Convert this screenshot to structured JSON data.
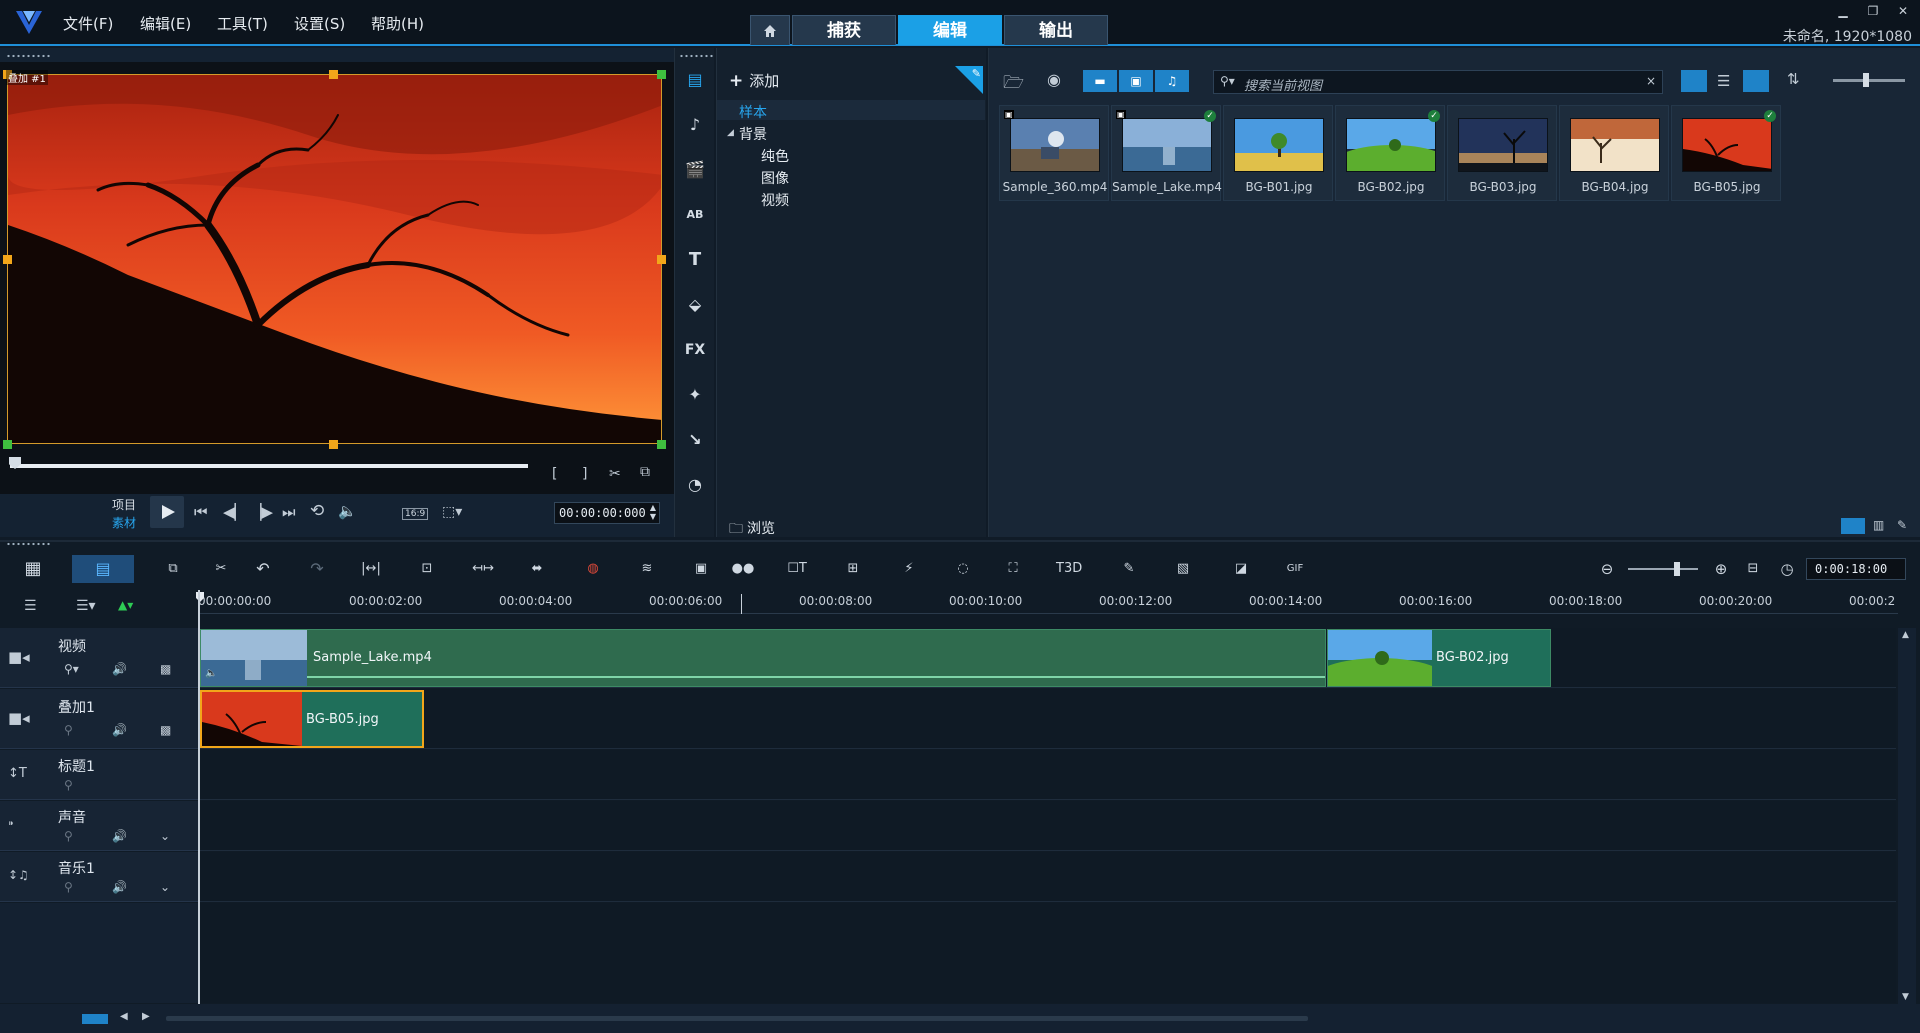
{
  "menubar": {
    "items": [
      "文件(F)",
      "编辑(E)",
      "工具(T)",
      "设置(S)",
      "帮助(H)"
    ],
    "tabs": [
      "捕获",
      "编辑",
      "输出"
    ],
    "active_tab": "编辑",
    "project_info": "未命名, 1920*1080"
  },
  "preview": {
    "overlay_label": "叠加 #1",
    "mode_project": "项目",
    "mode_clip": "素材",
    "aspect": "16:9",
    "timecode": "00:00:00:000"
  },
  "library": {
    "add_label": "添加",
    "tree": {
      "sample": "样本",
      "background": "背景",
      "children": [
        "纯色",
        "图像",
        "视频"
      ]
    },
    "browse_label": "浏览",
    "search_placeholder": "搜索当前视图",
    "items": [
      {
        "name": "Sample_360.mp4",
        "checked": false
      },
      {
        "name": "Sample_Lake.mp4",
        "checked": true
      },
      {
        "name": "BG-B01.jpg",
        "checked": false
      },
      {
        "name": "BG-B02.jpg",
        "checked": true
      },
      {
        "name": "BG-B03.jpg",
        "checked": false
      },
      {
        "name": "BG-B04.jpg",
        "checked": false
      },
      {
        "name": "BG-B05.jpg",
        "checked": true
      }
    ]
  },
  "timeline": {
    "zoom_timecode": "0:00:18:00",
    "ruler": [
      "00:00:00:00",
      "00:00:02:00",
      "00:00:04:00",
      "00:00:06:00",
      "00:00:08:00",
      "00:00:10:00",
      "00:00:12:00",
      "00:00:14:00",
      "00:00:16:00",
      "00:00:18:00",
      "00:00:20:00",
      "00:00:2"
    ],
    "tracks": [
      "视频",
      "叠加1",
      "标题1",
      "声音",
      "音乐1"
    ],
    "clips": {
      "video_1": "Sample_Lake.mp4",
      "video_2": "BG-B02.jpg",
      "overlay_1": "BG-B05.jpg"
    }
  }
}
